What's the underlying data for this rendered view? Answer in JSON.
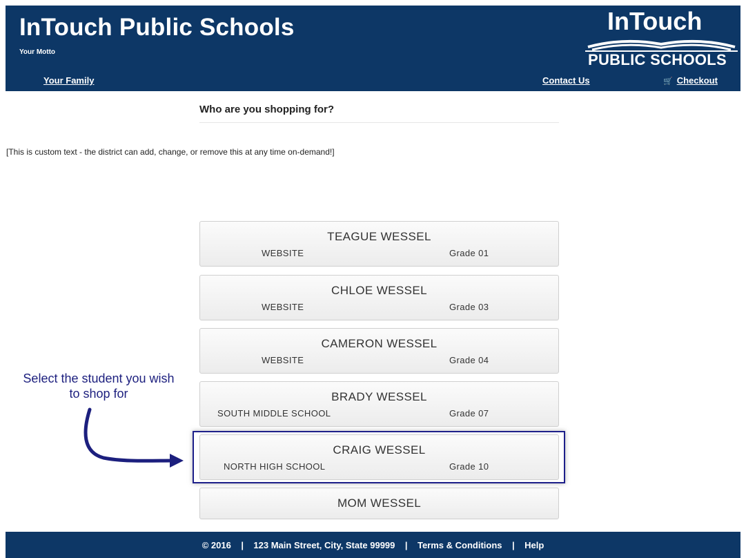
{
  "header": {
    "title": "InTouch Public Schools",
    "motto": "Your Motto",
    "logo_top": "InTouch",
    "logo_bottom": "PUBLIC SCHOOLS",
    "nav": {
      "family": "Your Family",
      "contact": "Contact Us",
      "checkout": "Checkout"
    }
  },
  "main": {
    "question": "Who are you shopping for?",
    "custom_text": "[This is custom text - the district can add, change, or remove this at any time on-demand!]",
    "students": [
      {
        "name": "TEAGUE WESSEL",
        "school": "WEBSITE",
        "grade": "Grade 01"
      },
      {
        "name": "CHLOE WESSEL",
        "school": "WEBSITE",
        "grade": "Grade 03"
      },
      {
        "name": "CAMERON WESSEL",
        "school": "WEBSITE",
        "grade": "Grade 04"
      },
      {
        "name": "BRADY WESSEL",
        "school": "SOUTH MIDDLE SCHOOL",
        "grade": "Grade 07"
      },
      {
        "name": "CRAIG WESSEL",
        "school": "NORTH HIGH SCHOOL",
        "grade": "Grade 10"
      },
      {
        "name": "MOM WESSEL"
      }
    ],
    "annotation": "Select the student you wish to shop for"
  },
  "footer": {
    "copyright": "© 2016",
    "address": "123 Main Street, City, State 99999",
    "terms": "Terms & Conditions",
    "help": "Help",
    "separator": "|"
  },
  "colors": {
    "brand_navy": "#0d3766",
    "annotation_blue": "#1c1f7e"
  },
  "icons": {
    "checkout": "cart-icon"
  }
}
